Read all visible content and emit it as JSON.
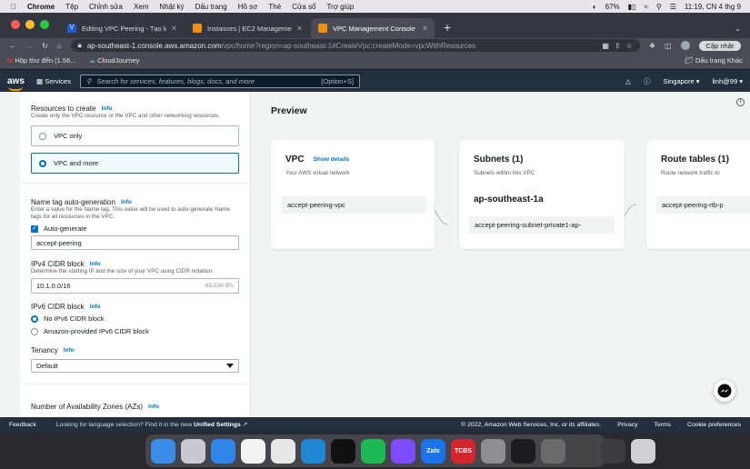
{
  "menubar": {
    "app": "Chrome",
    "items": [
      "Tệp",
      "Chỉnh sửa",
      "Xem",
      "Nhật ký",
      "Dấu trang",
      "Hồ sơ",
      "Thẻ",
      "Cửa sổ",
      "Trợ giúp"
    ],
    "battery": "67%",
    "clock": "11:19, CN 4 thg 9"
  },
  "tabs": [
    {
      "title": "Editing VPC Peering - Tạo kết",
      "color": "#1d5fd1"
    },
    {
      "title": "Instances | EC2 Management",
      "color": "#f29111"
    },
    {
      "title": "VPC Management Console",
      "color": "#f29111"
    }
  ],
  "toolbar": {
    "url_host": "ap-southeast-1.console.aws.amazon.com",
    "url_path": "/vpc/home?region=ap-southeast-1#CreateVpc:createMode=vpcWithResources",
    "update_label": "Cập nhật"
  },
  "bookmarks": {
    "items": [
      "Hộp thư đến (1.56...",
      "CloudJourney"
    ],
    "other": "Dấu trang Khác"
  },
  "awsnav": {
    "services": "Services",
    "search_placeholder": "Search for services, features, blogs, docs, and more",
    "shortcut": "[Option+S]",
    "region": "Singapore",
    "user": "linh@99"
  },
  "form": {
    "resources": {
      "label": "Resources to create",
      "info": "Info",
      "desc": "Create only the VPC resource or the VPC and other networking resources.",
      "options": [
        "VPC only",
        "VPC and more"
      ],
      "selected": "VPC and more"
    },
    "nametag": {
      "label": "Name tag auto-generation",
      "info": "Info",
      "desc": "Enter a value for the Name tag. This value will be used to auto-generate Name tags for all resources in the VPC.",
      "auto_label": "Auto-generate",
      "value": "accept-peering"
    },
    "ipv4": {
      "label": "IPv4 CIDR block",
      "info": "Info",
      "desc": "Determine the starting IP and the size of your VPC using CIDR notation.",
      "value": "10.1.0.0/16",
      "hint": "65,536 IPs"
    },
    "ipv6": {
      "label": "IPv6 CIDR block",
      "info": "Info",
      "options": [
        "No IPv6 CIDR block",
        "Amazon-provided IPv6 CIDR block"
      ],
      "selected": "No IPv6 CIDR block"
    },
    "tenancy": {
      "label": "Tenancy",
      "info": "Info",
      "value": "Default"
    },
    "azs": {
      "label": "Number of Availability Zones (AZs)",
      "info": "Info"
    }
  },
  "preview": {
    "title": "Preview",
    "vpc": {
      "title": "VPC",
      "show_details": "Show details",
      "sub": "Your AWS virtual network",
      "node": "accept-peering-vpc"
    },
    "subnets": {
      "title": "Subnets (1)",
      "sub": "Subnets within this VPC",
      "az": "ap-southeast-1a",
      "node": "accept-peering-subnet-private1-ap-"
    },
    "routes": {
      "title": "Route tables (1)",
      "sub": "Route network traffic to",
      "node": "accept-peering-rtb-p"
    }
  },
  "footer": {
    "feedback": "Feedback",
    "msg": "Looking for language selection? Find it in the new",
    "unified": "Unified Settings",
    "copyright": "© 2022, Amazon Web Services, Inc. or its affiliates.",
    "privacy": "Privacy",
    "terms": "Terms",
    "cookies": "Cookie preferences"
  },
  "dock": {
    "apps": [
      {
        "name": "finder",
        "color": "#3b8ee8"
      },
      {
        "name": "launchpad",
        "color": "#c9c9d1"
      },
      {
        "name": "safari",
        "color": "#2f86e8"
      },
      {
        "name": "photos",
        "color": "#f3f3f3"
      },
      {
        "name": "chrome",
        "color": "#e7e7e7"
      },
      {
        "name": "vscode",
        "color": "#1e88d3"
      },
      {
        "name": "terminal",
        "color": "#111111"
      },
      {
        "name": "spotify",
        "color": "#1db954"
      },
      {
        "name": "messenger",
        "color": "#7b4dff"
      },
      {
        "name": "zalo",
        "color": "#1a73e8",
        "label": "Zalo"
      },
      {
        "name": "tcbs",
        "color": "#d5262f",
        "label": "TCBS"
      },
      {
        "name": "system-preferences",
        "color": "#8e8e93"
      },
      {
        "name": "circle-app",
        "color": "#1c1c1e"
      },
      {
        "name": "preview-app",
        "color": "#6b6b6b"
      },
      {
        "name": "screen-app",
        "color": "#444444"
      },
      {
        "name": "downloads",
        "color": "#3d3d40"
      },
      {
        "name": "trash",
        "color": "#cfcfd4"
      }
    ]
  },
  "colors": {
    "aws_orange": "#ff9900",
    "link_blue": "#0073bb",
    "aws_nav": "#232f3e"
  }
}
